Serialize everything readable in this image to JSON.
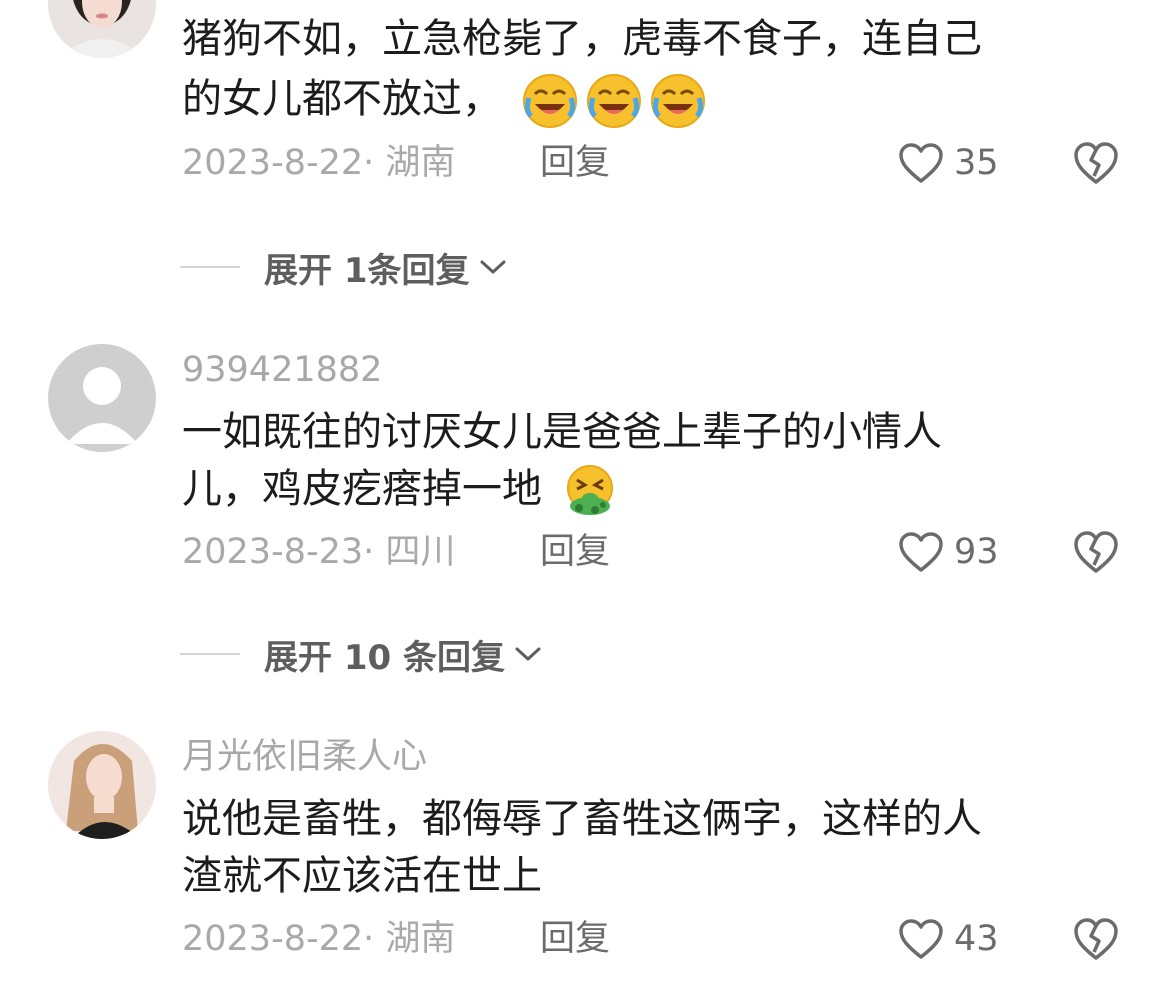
{
  "comments": [
    {
      "username": "",
      "text_line1": "猪狗不如，立急枪毙了，虎毒不食子，连自己",
      "text_line2": "的女儿都不放过，",
      "emoji": [
        "laughing-crying-emoji",
        "laughing-crying-emoji",
        "laughing-crying-emoji"
      ],
      "date_location": "2023-8-22· 湖南",
      "reply_label": "回复",
      "likes": "35",
      "expand_label": "展开 1条回复"
    },
    {
      "username": "939421882",
      "text_line1": "一如既往的讨厌女儿是爸爸上辈子的小情人",
      "text_line2": "儿，鸡皮疙瘩掉一地",
      "emoji": [
        "vomiting-emoji"
      ],
      "date_location": "2023-8-23· 四川",
      "reply_label": "回复",
      "likes": "93",
      "expand_label": "展开 10 条回复"
    },
    {
      "username": "月光依旧柔人心",
      "text_line1": "说他是畜牲，都侮辱了畜牲这俩字，这样的人",
      "text_line2": "渣就不应该活在世上",
      "date_location": "2023-8-22· 湖南",
      "reply_label": "回复",
      "likes": "43"
    }
  ],
  "colors": {
    "text": "#1c1c1c",
    "muted": "#a9a9a9",
    "action": "#6b6b6b",
    "emoji_yellow": "#f7c12e",
    "emoji_green": "#4caf50"
  }
}
